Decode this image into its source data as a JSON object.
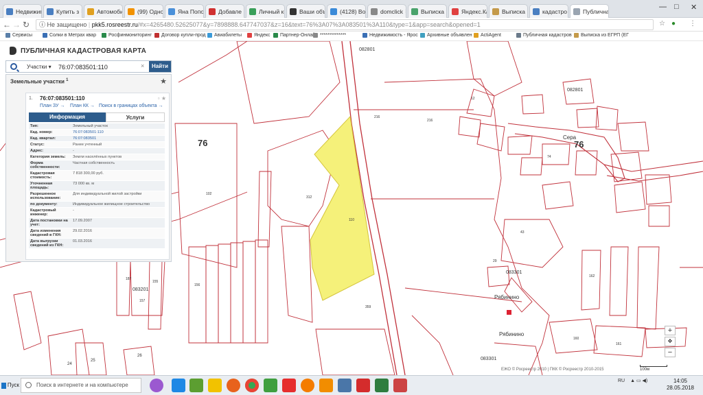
{
  "browser": {
    "tabs": [
      {
        "label": "Недвижим",
        "color": "#4a7fc1"
      },
      {
        "label": "Купить з",
        "color": "#4a7fc1"
      },
      {
        "label": "Автомоби",
        "color": "#e0a020"
      },
      {
        "label": "(99) Одно",
        "color": "#f29200"
      },
      {
        "label": "Яна Попо",
        "color": "#4a90d9"
      },
      {
        "label": "Добавле",
        "color": "#d03030"
      },
      {
        "label": "Личный к",
        "color": "#3a9f5a"
      },
      {
        "label": "Ваши объ",
        "color": "#333333"
      },
      {
        "label": "(4128) Во",
        "color": "#3b8ad8"
      },
      {
        "label": "domclick",
        "color": "#888888"
      },
      {
        "label": "Выписка",
        "color": "#4aa36c"
      },
      {
        "label": "Яндекс.Ка",
        "color": "#e04040"
      },
      {
        "label": "Выписка",
        "color": "#c49a4a"
      },
      {
        "label": "кадастро",
        "color": "#4a7fc1"
      },
      {
        "label": "Публичная",
        "color": "#9aa5b1"
      }
    ],
    "window_controls": {
      "minimize": "—",
      "maximize": "□",
      "close": "✕"
    },
    "address": {
      "security": "Не защищено",
      "host": "pkk5.rosreestr.ru",
      "path": "/#x=4265480.52625077&y=7898888.647747037&z=16&text=76%3A07%3A083501%3A110&type=1&app=search&opened=1"
    },
    "bookmarks": [
      {
        "label": "Сервисы",
        "color": "#5a7fa8"
      },
      {
        "label": "Солки в Метрах квар",
        "color": "#3a6fb5"
      },
      {
        "label": "Росфинмониторинг",
        "color": "#2a8a4a"
      },
      {
        "label": "Договор купли-прод",
        "color": "#c03030"
      },
      {
        "label": "Авиабилеты",
        "color": "#3a9ad8"
      },
      {
        "label": "Яндекс",
        "color": "#e04040"
      },
      {
        "label": "Партнер-Онлайн",
        "color": "#2a8a4a"
      },
      {
        "label": "**************",
        "color": "#888888"
      },
      {
        "label": "Недвижимость - Ярос",
        "color": "#3a6fb5"
      },
      {
        "label": "Архивные объявлен",
        "color": "#40a0c0"
      },
      {
        "label": "ActiAgent",
        "color": "#e0a020"
      },
      {
        "label": "Публичная кадастров",
        "color": "#6a7a8a"
      },
      {
        "label": "Выписка из ЕГРП (ЕГ",
        "color": "#c49a4a"
      }
    ]
  },
  "panel": {
    "title": "ПУБЛИЧНАЯ КАДАСТРОВАЯ КАРТА",
    "search": {
      "type_label": "Участки",
      "query": "76:07:083501:110",
      "clear": "×",
      "button": "Найти"
    },
    "results": {
      "heading": "Земельные участки",
      "count": "1",
      "item": {
        "index": "1.",
        "cad_number": "76:07:083501:110",
        "links": [
          "План ЗУ →",
          "План КК →",
          "Поиск в границах объекта →"
        ],
        "tabs": [
          "Информация",
          "Услуги"
        ],
        "properties": [
          {
            "key": "Тип:",
            "value": "Земельный участок",
            "link": false
          },
          {
            "key": "Кад. номер:",
            "value": "76:07:083501:110",
            "link": true
          },
          {
            "key": "Кад. квартал:",
            "value": "76:07:083501",
            "link": true
          },
          {
            "key": "Статус:",
            "value": "Ранее учтенный",
            "link": false
          },
          {
            "key": "Адрес:",
            "value": "-",
            "link": false
          },
          {
            "key": "Категория земель:",
            "value": "Земли населённых пунктов",
            "link": false
          },
          {
            "key": "Форма собственности:",
            "value": "Частная собственность",
            "link": false
          },
          {
            "key": "Кадастровая стоимость:",
            "value": "7 818 300,00 руб.",
            "link": false
          },
          {
            "key": "Уточненная площадь:",
            "value": "73 000 кв. м",
            "link": false
          },
          {
            "key": "Разрешенное использование:",
            "value": "Для индивидуальной жилой застройки",
            "link": false
          },
          {
            "key": "по документу:",
            "value": "Индивидуальное жилищное строительство",
            "link": false
          },
          {
            "key": "Кадастровый инженер:",
            "value": "-",
            "link": false
          },
          {
            "key": "Дата постановки на учет:",
            "value": "17.09.2007",
            "link": false
          },
          {
            "key": "Дата изменения сведений в ГКН:",
            "value": "29.02.2016",
            "link": false
          },
          {
            "key": "Дата выгрузки сведений из ГКН:",
            "value": "01.03.2016",
            "link": false
          }
        ]
      }
    }
  },
  "map": {
    "labels": {
      "region_left": "76",
      "region_right": "76",
      "q_082801_top": "082801",
      "q_082801_right": "082801",
      "q_083201": "083201",
      "q_083301_a": "083301",
      "q_083301_b": "083301",
      "place_sera": "Сера",
      "place_ryabinino_1": "Рябинино",
      "place_ryabinino_2": "Рябинино",
      "p102": "102",
      "p216a": "216",
      "p216b": "216",
      "p312": "312",
      "p110": "110",
      "p359": "359",
      "p43": "43",
      "p162": "162",
      "p160": "160",
      "p161": "161",
      "p24": "24",
      "p25": "25",
      "p26": "26",
      "p29": "29",
      "p74": "74",
      "p12": "12",
      "p187": "187",
      "p157": "157",
      "p155": "155",
      "p156": "156"
    },
    "zoom_in": "+",
    "zoom_out": "−",
    "copyright": "ЕЖО © Росреестр 2010 | ПКК © Росреестр 2010-2015",
    "scale": "100м",
    "highlight_color": "#f5f17a",
    "boundary_color": "#c0303a"
  },
  "taskbar": {
    "start": "Пуск",
    "search_placeholder": "Поиск в интернете и на компьютере",
    "lang": "RU",
    "time": "14:05",
    "date": "28.05.2018"
  }
}
